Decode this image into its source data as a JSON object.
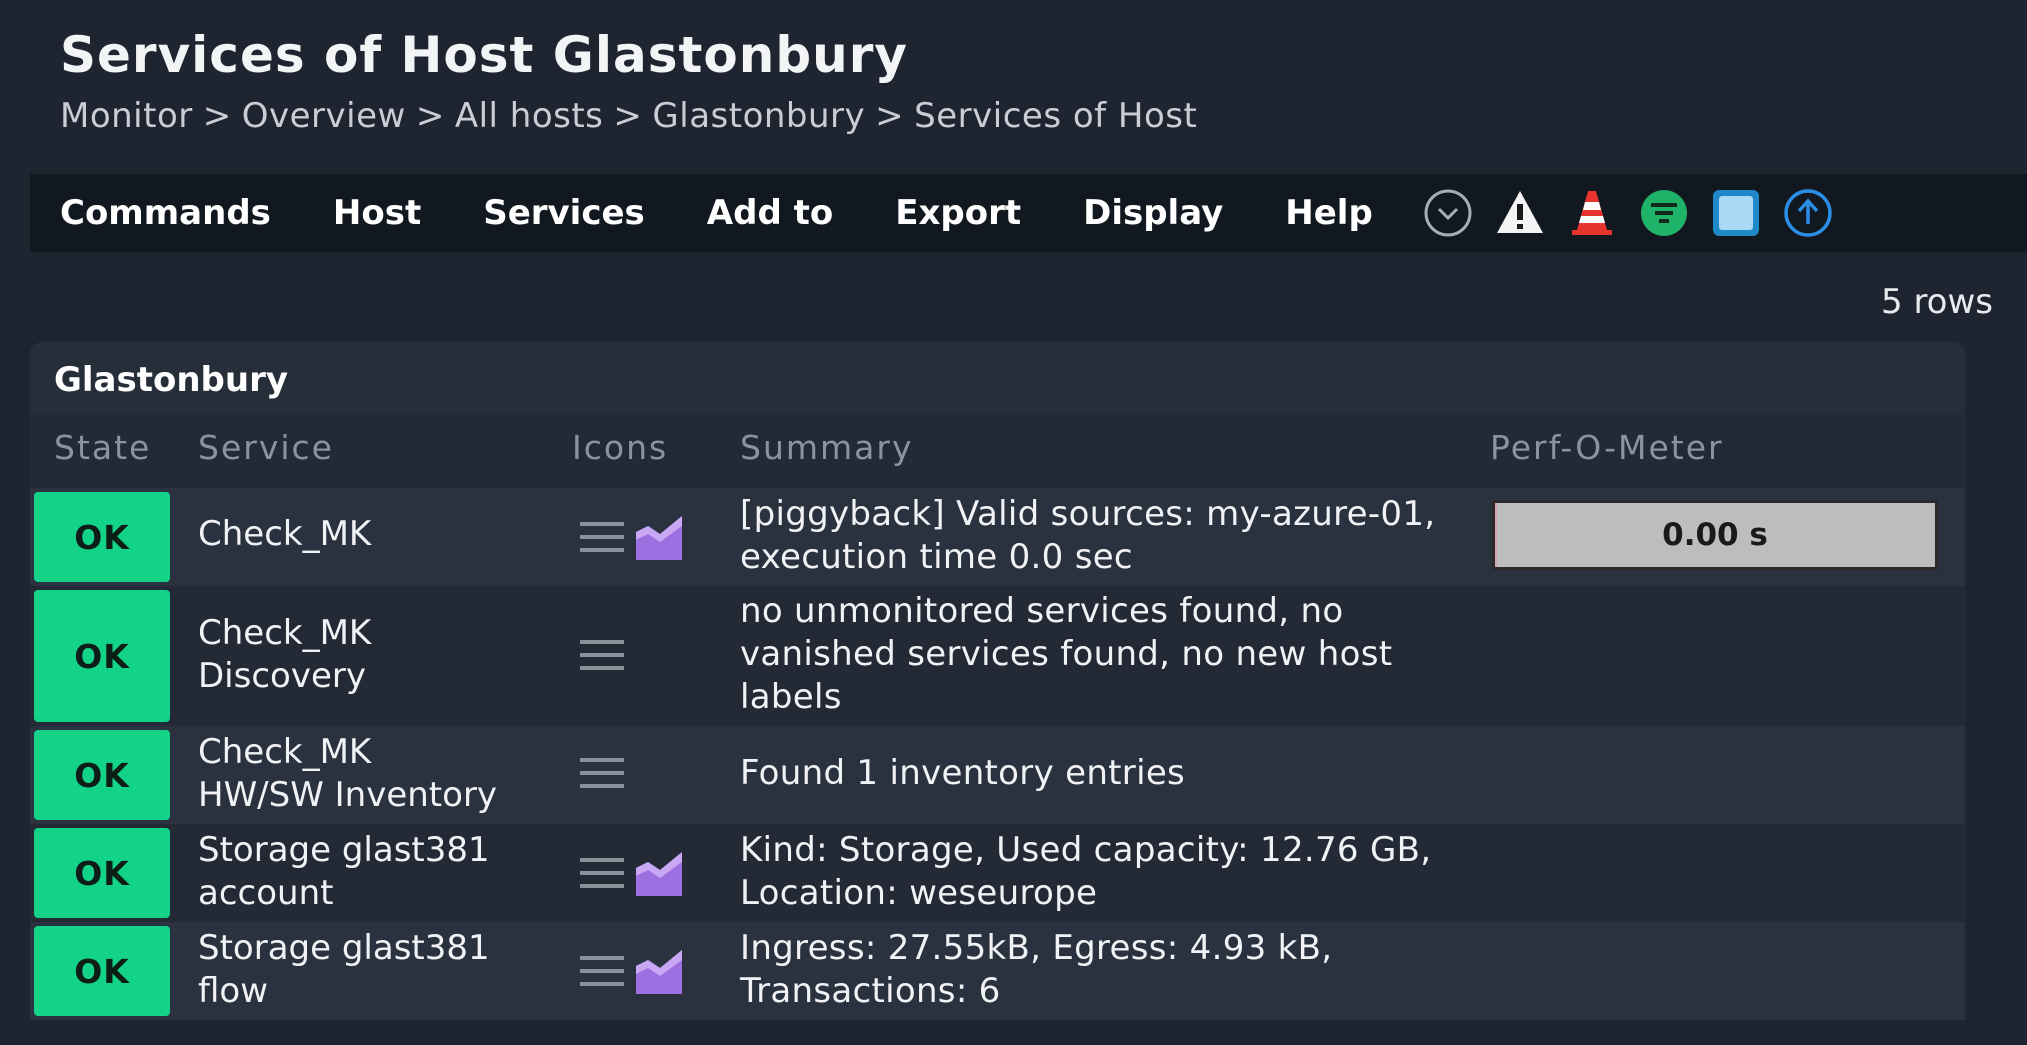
{
  "page": {
    "title": "Services of Host Glastonbury",
    "breadcrumb": [
      "Monitor",
      "Overview",
      "All hosts",
      "Glastonbury",
      "Services of Host"
    ],
    "breadcrumb_sep": ">"
  },
  "menu": {
    "items": [
      "Commands",
      "Host",
      "Services",
      "Add to",
      "Export",
      "Display",
      "Help"
    ],
    "tool_icons": [
      "chevron-down-circle-icon",
      "warning-icon",
      "traffic-cone-icon",
      "filter-icon",
      "square-toggle-icon",
      "arrow-up-circle-icon"
    ]
  },
  "row_count": "5 rows",
  "table": {
    "host": "Glastonbury",
    "columns": [
      "State",
      "Service",
      "Icons",
      "Summary",
      "Perf-O-Meter"
    ],
    "rows": [
      {
        "state": "OK",
        "service": [
          "Check_MK"
        ],
        "icons": [
          "menu-icon",
          "graph-icon"
        ],
        "summary": [
          "[piggyback] Valid sources: my-azure-01,",
          "execution time 0.0 sec"
        ],
        "perf": "0.00 s",
        "perf_fraction": 0.005
      },
      {
        "state": "OK",
        "service": [
          "Check_MK",
          "Discovery"
        ],
        "icons": [
          "menu-icon"
        ],
        "summary": [
          "no unmonitored services found, no",
          "vanished services found, no new host",
          "labels"
        ]
      },
      {
        "state": "OK",
        "service": [
          "Check_MK",
          "HW/SW Inventory"
        ],
        "icons": [
          "menu-icon"
        ],
        "summary": [
          "Found 1 inventory entries"
        ]
      },
      {
        "state": "OK",
        "service": [
          "Storage glast381",
          "account"
        ],
        "icons": [
          "menu-icon",
          "graph-icon"
        ],
        "summary": [
          "Kind: Storage, Used capacity: 12.76 GB,",
          "Location: weseurope"
        ]
      },
      {
        "state": "OK",
        "service": [
          "Storage glast381",
          "flow"
        ],
        "icons": [
          "menu-icon",
          "graph-icon"
        ],
        "summary": [
          "Ingress: 27.55kB, Egress: 4.93 kB,",
          "Transactions: 6"
        ]
      }
    ]
  },
  "colors": {
    "ok": "#13d389",
    "background": "#1f2530",
    "menubar": "#121820",
    "graph_icon": "#a070e0"
  }
}
